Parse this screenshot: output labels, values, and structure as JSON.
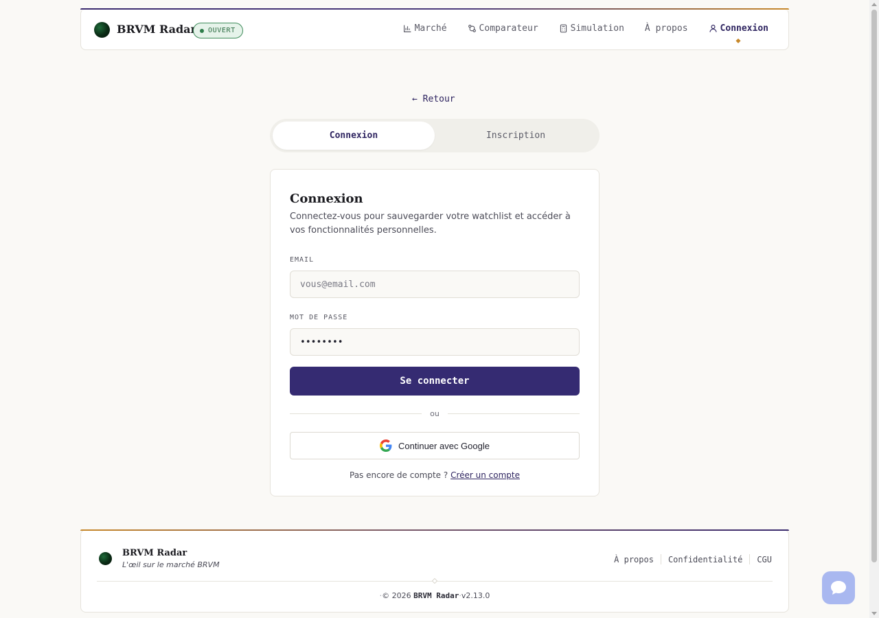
{
  "header": {
    "brand": "BRVM Radar",
    "status": "OUVERT",
    "nav": [
      {
        "label": "Marché",
        "icon": "bar-chart-icon"
      },
      {
        "label": "Comparateur",
        "icon": "compare-icon"
      },
      {
        "label": "Simulation",
        "icon": "calculator-icon"
      },
      {
        "label": "À propos",
        "icon": ""
      },
      {
        "label": "Connexion",
        "icon": "user-icon",
        "active": true
      }
    ]
  },
  "back_link": "← Retour",
  "tabs": {
    "login": "Connexion",
    "signup": "Inscription"
  },
  "card": {
    "title": "Connexion",
    "description": "Connectez-vous pour sauvegarder votre watchlist et accéder à vos fonctionnalités personnelles.",
    "email_label": "EMAIL",
    "email_placeholder": "vous@email.com",
    "password_label": "MOT DE PASSE",
    "password_value": "••••••••",
    "submit": "Se connecter",
    "divider": "ou",
    "google": "Continuer avec Google",
    "no_account": "Pas encore de compte ?",
    "create_account": "Créer un compte"
  },
  "footer": {
    "brand": "BRVM Radar",
    "tagline": "L'œil sur le marché BRVM",
    "links": [
      "À propos",
      "Confidentialité",
      "CGU"
    ],
    "copyright_prefix": "© 2026",
    "copyright_brand": "BRVM Radar",
    "version": "v2.13.0"
  },
  "colors": {
    "primary": "#352b72",
    "accent": "#c7882a",
    "status_green": "#2e7d4a",
    "background": "#faf9f6"
  }
}
